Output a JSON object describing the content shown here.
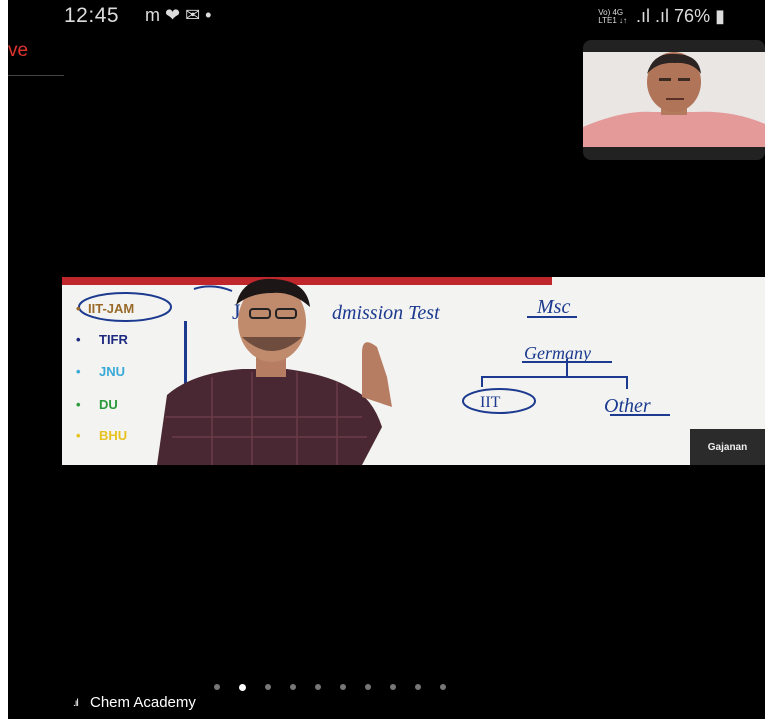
{
  "status_bar": {
    "time": "12:45",
    "left_icons": [
      "m-icon",
      "heart-icon",
      "mail-icon",
      "dot-icon"
    ],
    "left_icons_text": "m ❤ ✉ •",
    "network_labels": "Vo) 4G",
    "network_sub": "LTE1 ↓↑",
    "signal_text": ".ıl .ıl",
    "battery": "76%"
  },
  "live": {
    "label": "ve"
  },
  "video": {
    "list_items": [
      "IIT-JAM",
      "TIFR",
      "JNU",
      "DU",
      "BHU"
    ],
    "whiteboard_text": [
      "Jo",
      "dmission Test",
      "Msc",
      "Germany",
      "IIT",
      "Other"
    ],
    "participant_name": "Gajanan"
  },
  "bottom": {
    "meeting_name": "Chem Academy",
    "page_count": 10,
    "active_page": 2
  }
}
